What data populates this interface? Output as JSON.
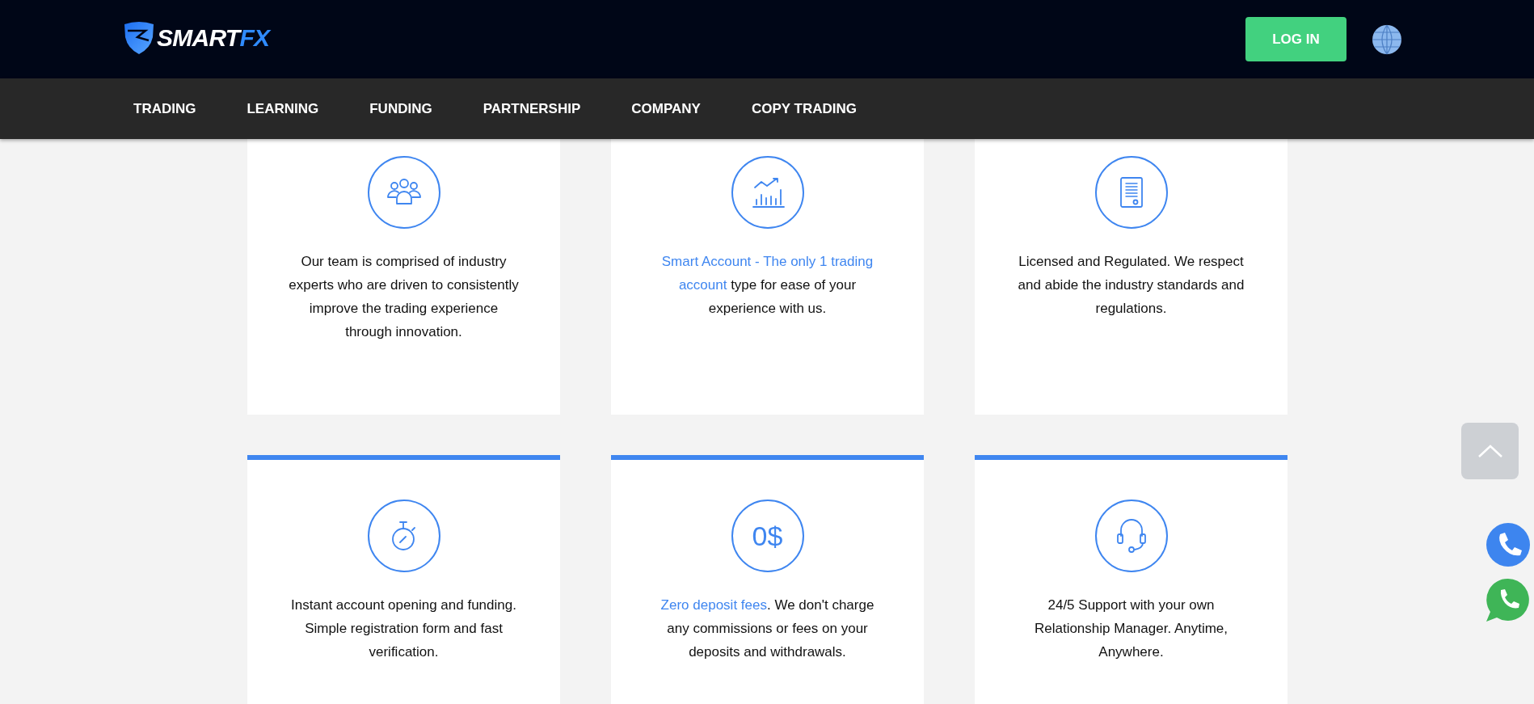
{
  "header": {
    "logo": {
      "word": "SMART",
      "accent": "FX"
    },
    "login_button": "LOG IN"
  },
  "nav": {
    "items": [
      "TRADING",
      "LEARNING",
      "FUNDING",
      "PARTNERSHIP",
      "COMPANY",
      "COPY TRADING"
    ]
  },
  "feature_rows": [
    {
      "cards": [
        {
          "parts": [
            {
              "text": "Our team is comprised of industry experts who are driven to consistently improve the trading experience through innovation.",
              "highlight": false
            }
          ]
        },
        {
          "parts": [
            {
              "text": "Smart Account - The only 1 trading account",
              "highlight": true
            },
            {
              "text": " type for ease of your experience with us.",
              "highlight": false
            }
          ]
        },
        {
          "parts": [
            {
              "text": "Licensed and Regulated. We respect and abide the industry standards and regulations.",
              "highlight": false
            }
          ]
        }
      ]
    },
    {
      "cards": [
        {
          "parts": [
            {
              "text": "Instant account opening and funding. Simple registration form and fast verification.",
              "highlight": false
            }
          ]
        },
        {
          "icon_text": "0$",
          "parts": [
            {
              "text": "Zero deposit fees",
              "highlight": true
            },
            {
              "text": ". We don't charge any commissions or fees on your deposits and withdrawals.",
              "highlight": false
            }
          ]
        },
        {
          "parts": [
            {
              "text": "24/5 Support with your own Relationship Manager. Anytime, Anywhere.",
              "highlight": false
            }
          ]
        }
      ]
    }
  ]
}
